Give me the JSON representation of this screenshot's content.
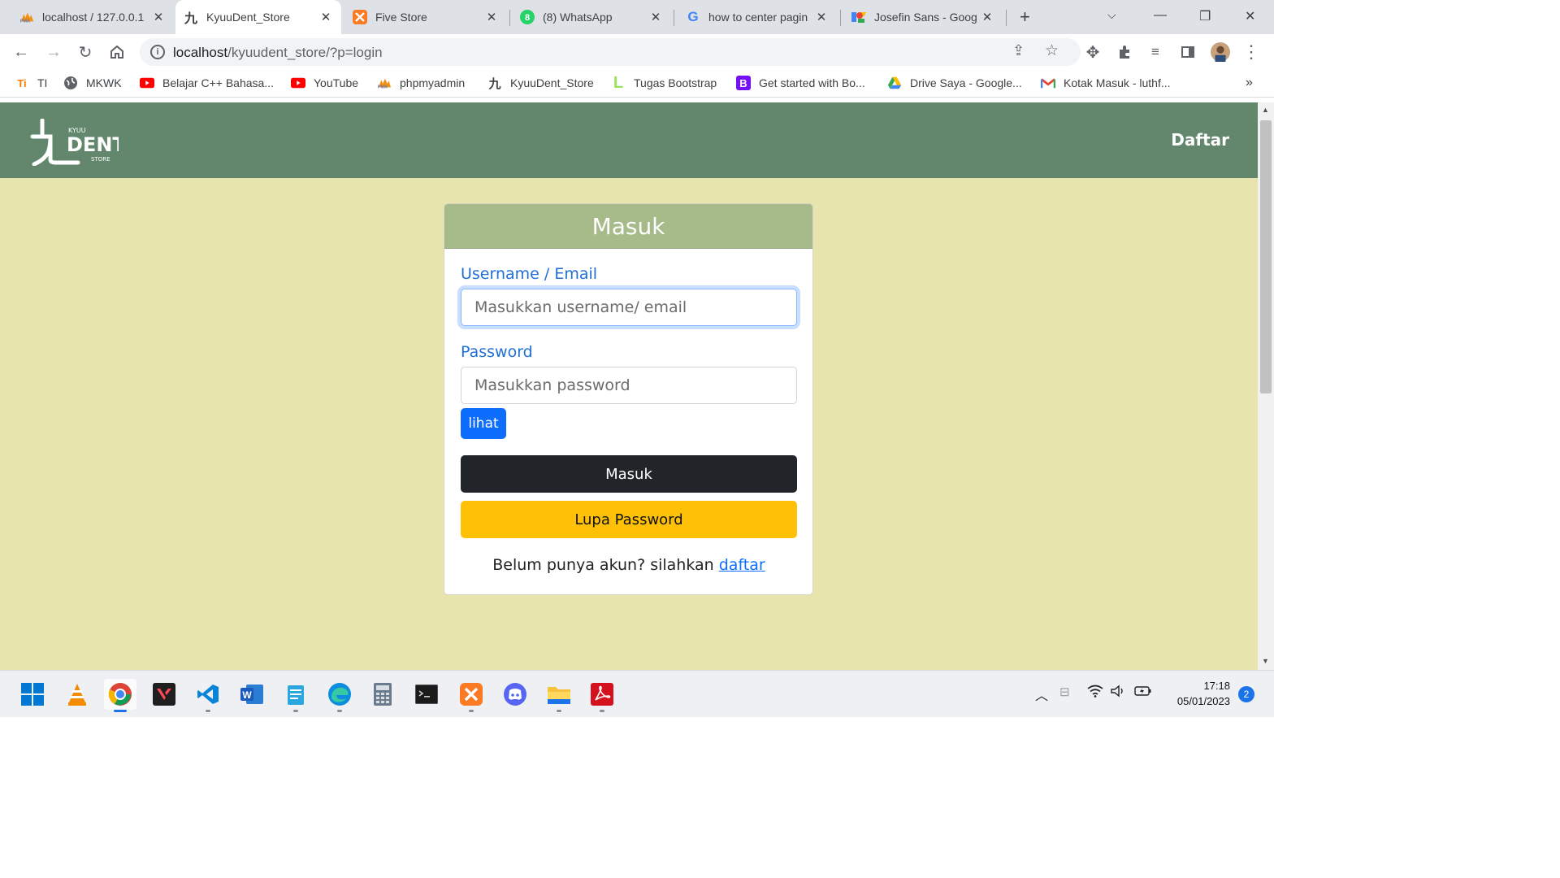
{
  "browser": {
    "tabs": [
      {
        "title": "localhost / 127.0.0.1",
        "icon": "phpmyadmin-icon"
      },
      {
        "title": "KyuuDent_Store",
        "icon": "kyuudent-icon"
      },
      {
        "title": "Five Store",
        "icon": "xampp-icon"
      },
      {
        "title": "(8) WhatsApp",
        "icon": "whatsapp-icon",
        "badge": "8"
      },
      {
        "title": "how to center pagin",
        "icon": "google-icon"
      },
      {
        "title": "Josefin Sans - Goog",
        "icon": "google-fonts-icon"
      }
    ],
    "active_tab": 1,
    "url_host": "localhost",
    "url_path": "/kyuudent_store/?p=login",
    "bookmarks": [
      {
        "label": "TI",
        "icon": "ti-icon"
      },
      {
        "label": "MKWK",
        "icon": "globe-icon"
      },
      {
        "label": "Belajar C++ Bahasa...",
        "icon": "youtube-icon"
      },
      {
        "label": "YouTube",
        "icon": "youtube-icon"
      },
      {
        "label": "phpmyadmin",
        "icon": "phpmyadmin-icon"
      },
      {
        "label": "KyuuDent_Store",
        "icon": "kyuudent-icon"
      },
      {
        "label": "Tugas Bootstrap",
        "icon": "l-icon"
      },
      {
        "label": "Get started with Bo...",
        "icon": "bootstrap-icon"
      },
      {
        "label": "Drive Saya - Google...",
        "icon": "google-drive-icon"
      },
      {
        "label": "Kotak Masuk - luthf...",
        "icon": "gmail-icon"
      }
    ]
  },
  "site": {
    "logo": {
      "kanji": "九",
      "top": "KYUU",
      "main": "DENT",
      "sub": "STORE"
    },
    "nav_link": "Daftar",
    "login": {
      "title": "Masuk",
      "username_label": "Username / Email",
      "username_placeholder": "Masukkan username/ email",
      "password_label": "Password",
      "password_placeholder": "Masukkan password",
      "show_button": "lihat",
      "submit_button": "Masuk",
      "forgot_button": "Lupa Password",
      "register_prompt": "Belum punya akun? silahkan",
      "register_link": "daftar"
    },
    "colors": {
      "navbar": "#62876d",
      "background": "#e8e4ae",
      "card_header": "#a6ba8a",
      "label": "#1f6fd6"
    }
  },
  "taskbar": {
    "apps": [
      "start-icon",
      "vlc-icon",
      "chrome-icon",
      "valorant-icon",
      "vscode-icon",
      "word-icon",
      "notepad-icon",
      "edge-icon",
      "calculator-icon",
      "terminal-icon",
      "xampp-icon",
      "discord-icon",
      "file-explorer-icon",
      "acrobat-icon"
    ],
    "time": "17:18",
    "date": "05/01/2023",
    "notifications": "2"
  }
}
